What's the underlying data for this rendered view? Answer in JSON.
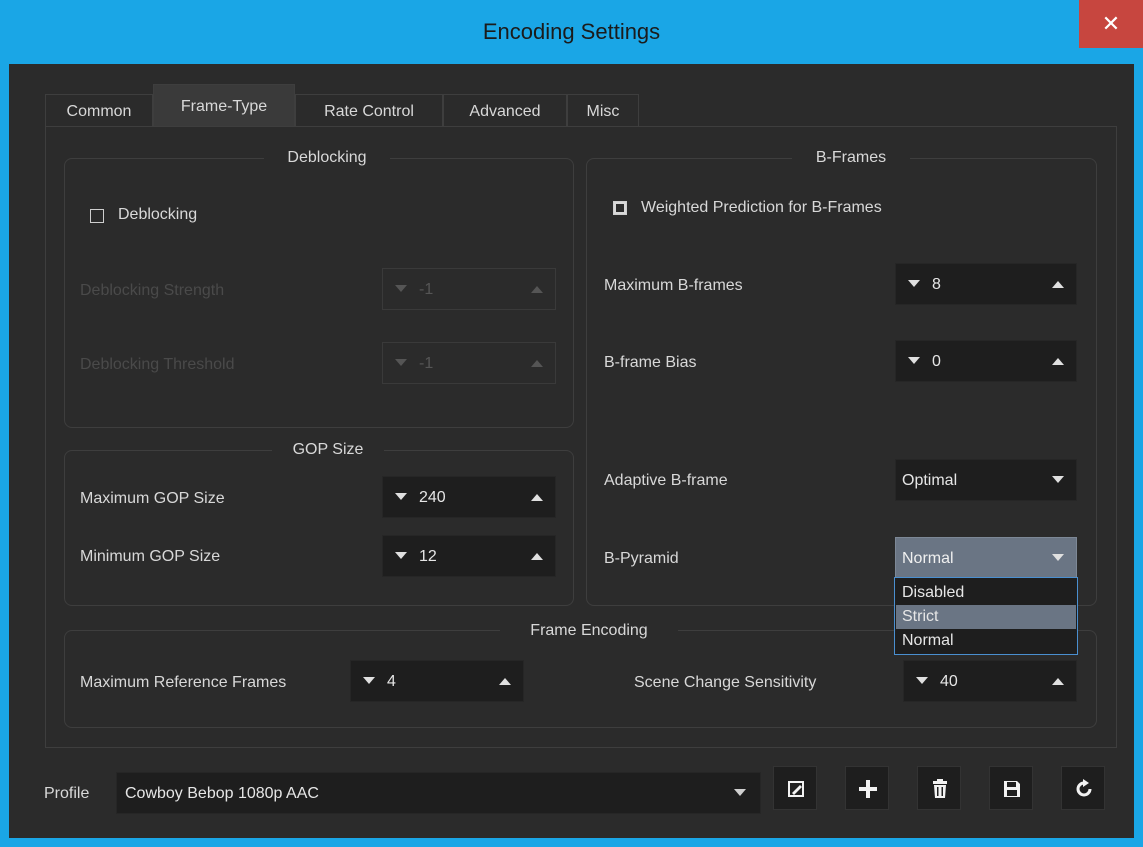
{
  "window": {
    "title": "Encoding Settings",
    "close_glyph": "✕"
  },
  "tabs": [
    {
      "label": "Common"
    },
    {
      "label": "Frame-Type",
      "active": true
    },
    {
      "label": "Rate Control"
    },
    {
      "label": "Advanced"
    },
    {
      "label": "Misc"
    }
  ],
  "deblocking": {
    "title": "Deblocking",
    "checkbox_label": "Deblocking",
    "checked": false,
    "strength_label": "Deblocking Strength",
    "strength_value": "-1",
    "threshold_label": "Deblocking Threshold",
    "threshold_value": "-1"
  },
  "gop": {
    "title": "GOP Size",
    "max_label": "Maximum GOP Size",
    "max_value": "240",
    "min_label": "Minimum GOP Size",
    "min_value": "12"
  },
  "bframes": {
    "title": "B-Frames",
    "weighted_label": "Weighted Prediction for B-Frames",
    "weighted_checked": true,
    "max_label": "Maximum B-frames",
    "max_value": "8",
    "bias_label": "B-frame Bias",
    "bias_value": "0",
    "adaptive_label": "Adaptive B-frame",
    "adaptive_value": "Optimal",
    "pyramid_label": "B-Pyramid",
    "pyramid_value": "Normal",
    "pyramid_options": [
      "Disabled",
      "Strict",
      "Normal"
    ],
    "pyramid_highlighted": "Strict"
  },
  "frame_encoding": {
    "title": "Frame Encoding",
    "ref_label": "Maximum Reference Frames",
    "ref_value": "4",
    "scene_label": "Scene Change Sensitivity",
    "scene_value": "40"
  },
  "profile": {
    "label": "Profile",
    "value": "Cowboy Bebop 1080p AAC",
    "buttons": [
      "edit-icon",
      "plus-icon",
      "trash-icon",
      "save-icon",
      "refresh-icon"
    ]
  },
  "colors": {
    "titlebar": "#1aa6e6",
    "close": "#c7463f",
    "background": "#2b2b2b",
    "field": "#1e1e1e",
    "selection": "#6a7584"
  }
}
